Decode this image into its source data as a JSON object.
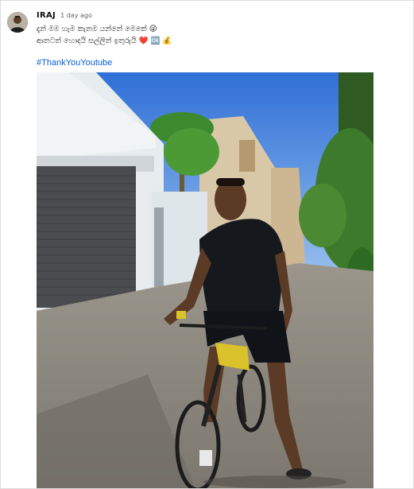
{
  "post": {
    "author": "IRAJ",
    "time": "1 day ago",
    "text_line1": "දැන් මම හැම කැනම යන්නේ මෙකේ 😜",
    "text_line2": "ආතටත් හොදයි සල්ලිත් ඉතුරුයි ❤️ 🆗 💰",
    "hashtag": "#ThankYouYoutube"
  },
  "icons": {
    "avatar": "user-avatar",
    "photo": "post-image-man-on-bicycle"
  },
  "colors": {
    "author": "#0f0f0f",
    "time": "#606060",
    "hashtag": "#065fd4",
    "background": "#f9f9f9"
  }
}
